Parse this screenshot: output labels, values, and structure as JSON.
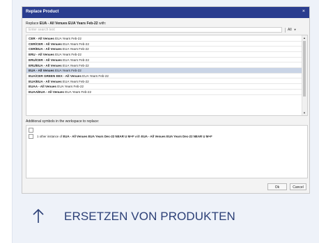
{
  "dialog": {
    "title": "Replace Product",
    "close_glyph": "×",
    "replace_prefix": "Replace ",
    "replace_product": "EUA - All Venues EUA Years Feb-22",
    "replace_suffix": " with:",
    "search_placeholder": "Enter search text",
    "filter_label": "All",
    "filter_icon": "chevron-down-icon",
    "products": [
      {
        "bold": "CER - All Venues",
        "rest": " EUA Years Feb-22",
        "selected": false
      },
      {
        "bold": "CER/CER - All Venues",
        "rest": " EUA Years Feb-22",
        "selected": false
      },
      {
        "bold": "CER/EUA - All Venues",
        "rest": " EUA Years Feb-22",
        "selected": false
      },
      {
        "bold": "ERU - All Venues",
        "rest": " EUA Years Feb-22",
        "selected": false
      },
      {
        "bold": "ERU/CER - All Venues",
        "rest": " EUA Years Feb-22",
        "selected": false
      },
      {
        "bold": "ERU/EUA - All Venues",
        "rest": " EUA Years Feb-22",
        "selected": false
      },
      {
        "bold": "EUA - All Venues",
        "rest": " EUA Years Feb-22",
        "selected": true
      },
      {
        "bold": "EUA/CER GREEN EEX - All Venues",
        "rest": " EUA Years Feb-22",
        "selected": false
      },
      {
        "bold": "EUA/EUA - All Venues",
        "rest": " EUA Years Feb-22",
        "selected": false
      },
      {
        "bold": "EUAA - All Venues",
        "rest": " EUA Years Feb-22",
        "selected": false
      },
      {
        "bold": "EUAA/EUA - All Venues",
        "rest": " EUA Years Feb-22",
        "selected": false
      }
    ],
    "additional_label": "Additional symbols in the workspace to replace:",
    "symbol": {
      "prefix": "1 other instance of ",
      "from": "EUA - All Venues EUA Years Dec-22 NEAR U M+F",
      "middle": " with ",
      "to": "EUA - All Venues EUA Years Dec-22 NEAR U M+F"
    },
    "ok_label": "Ok",
    "cancel_label": "Cancel"
  },
  "caption": {
    "icon": "arrow-up-icon",
    "text": "ERSETZEN VON PRODUKTEN",
    "color": "#2b3f76"
  },
  "colors": {
    "titlebar": "#2a3d8f",
    "selected_row": "#c9d4e6",
    "card_background": "#eef2f9"
  }
}
